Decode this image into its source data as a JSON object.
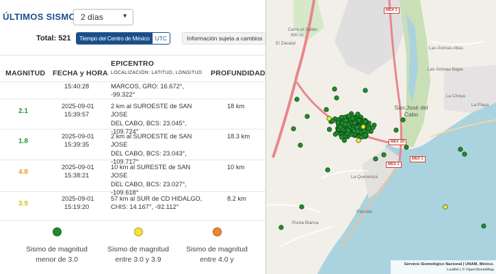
{
  "header": {
    "title": "ÚLTIMOS SISMOS.",
    "range_value": "2 días",
    "total_label": "Total:",
    "total_value": "521",
    "time_options": [
      "Tiempo del Centro de México",
      "UTC"
    ],
    "info_note": "Información sujeta a cambios"
  },
  "table": {
    "headers": {
      "magnitude": "MAGNITUD",
      "datetime": "FECHA y HORA",
      "epicenter": "EPICENTRO",
      "epicenter_sub": "LOCALIZACIÓN: LATITUD, LONGITUD",
      "depth": "PROFUNDIDAD"
    },
    "rows": [
      {
        "magnitude": "",
        "date": "",
        "time": "15:40:28",
        "epicenter_lines": [
          "MARCOS, GRO: 16.672°,",
          "-99.322°"
        ],
        "depth": "",
        "color": "#1f9a2e"
      },
      {
        "magnitude": "2.1",
        "date": "2025-09-01",
        "time": "15:39:57",
        "epicenter_lines": [
          "2 km al SUROESTE de SAN JOSE",
          "DEL CABO, BCS: 23.045°,",
          "-109.724°"
        ],
        "depth": "18 km",
        "color": "#1f9a2e"
      },
      {
        "magnitude": "1.8",
        "date": "2025-09-01",
        "time": "15:39:35",
        "epicenter_lines": [
          "2 km al SUROESTE de SAN JOSE",
          "DEL CABO, BCS: 23.043°,",
          "-109.717°"
        ],
        "depth": "18.3 km",
        "color": "#1f9a2e"
      },
      {
        "magnitude": "4.8",
        "date": "2025-09-01",
        "time": "15:38:21",
        "epicenter_lines": [
          "10 km al SURESTE de SAN JOSE",
          "DEL CABO, BCS: 23.027°,",
          "-109.618°"
        ],
        "depth": "10 km",
        "color": "#f0961e"
      },
      {
        "magnitude": "3.9",
        "date": "2025-09-01",
        "time": "15:19:20",
        "epicenter_lines": [
          "57 km al SUR de CD HIDALGO,",
          "CHIS: 14.167°, -92.112°"
        ],
        "depth": "8.2 km",
        "color": "#d6c51a"
      }
    ]
  },
  "legend": [
    {
      "text_lines": [
        "Sismo de magnitud",
        "menor de 3.0"
      ],
      "color": "#1f8a2e"
    },
    {
      "text_lines": [
        "Sismo de magnitud",
        "entre 3.0 y 3.9"
      ],
      "color": "#f2e23a"
    },
    {
      "text_lines": [
        "Sismo de magnitud",
        "entre 4.0 y"
      ],
      "color": "#f0862e"
    }
  ],
  "map": {
    "place_labels": [
      "Cerro el Saltito",
      "600 m",
      "Las Ánimas Altas",
      "Las Ánimas Bajas",
      "La Choya",
      "La Playa",
      "San José del Cabo",
      "La Querencia",
      "Palmilla",
      "El Zacatal",
      "Punta Blanca"
    ],
    "road_shields": [
      "MEX 1",
      "MEX 1D",
      "MEX 1",
      "MEX 1"
    ],
    "attribution_lines": [
      "Servicio Sismológico Nacional | UNAM, México.",
      "Leaflet | © OpenStreetMap"
    ],
    "marker_colors": {
      "small": "#1f8a2e",
      "medium": "#f2e23a",
      "large": "#f0862e"
    },
    "marker_count_visible": 521
  }
}
